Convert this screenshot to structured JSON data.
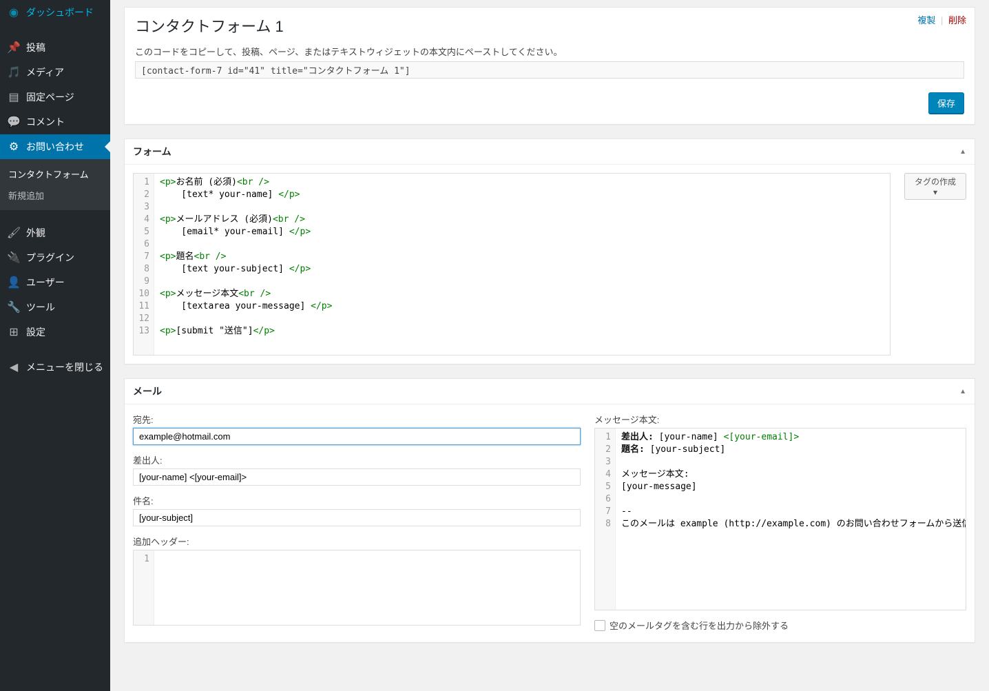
{
  "sidebar": {
    "items": [
      {
        "icon": "dashboard",
        "label": "ダッシュボード"
      },
      {
        "icon": "posts",
        "label": "投稿"
      },
      {
        "icon": "media",
        "label": "メディア"
      },
      {
        "icon": "pages",
        "label": "固定ページ"
      },
      {
        "icon": "comments",
        "label": "コメント"
      },
      {
        "icon": "contact",
        "label": "お問い合わせ",
        "current": true
      },
      {
        "icon": "appearance",
        "label": "外観"
      },
      {
        "icon": "plugins",
        "label": "プラグイン"
      },
      {
        "icon": "users",
        "label": "ユーザー"
      },
      {
        "icon": "tools",
        "label": "ツール"
      },
      {
        "icon": "settings",
        "label": "設定"
      },
      {
        "icon": "collapse",
        "label": "メニューを閉じる"
      }
    ],
    "submenu": [
      {
        "label": "コンタクトフォーム"
      },
      {
        "label": "新規追加"
      }
    ]
  },
  "title_actions": {
    "duplicate": "複製",
    "delete": "削除"
  },
  "page_title": "コンタクトフォーム 1",
  "shortcode_desc": "このコードをコピーして、投稿、ページ、またはテキストウィジェットの本文内にペーストしてください。",
  "shortcode_value": "[contact-form-7 id=\"41\" title=\"コンタクトフォーム 1\"]",
  "save_label": "保存",
  "form_section": {
    "title": "フォーム",
    "tag_button": "タグの作成 ▾",
    "code_lines": [
      {
        "n": 1,
        "parts": [
          {
            "t": "<p>",
            "c": "g"
          },
          {
            "t": "お名前 (必須)",
            "c": "d"
          },
          {
            "t": "<br />",
            "c": "g"
          }
        ]
      },
      {
        "n": 2,
        "parts": [
          {
            "t": "    [text* your-name] ",
            "c": "d"
          },
          {
            "t": "</p>",
            "c": "g"
          }
        ]
      },
      {
        "n": 3,
        "parts": []
      },
      {
        "n": 4,
        "parts": [
          {
            "t": "<p>",
            "c": "g"
          },
          {
            "t": "メールアドレス (必須)",
            "c": "d"
          },
          {
            "t": "<br />",
            "c": "g"
          }
        ]
      },
      {
        "n": 5,
        "parts": [
          {
            "t": "    [email* your-email] ",
            "c": "d"
          },
          {
            "t": "</p>",
            "c": "g"
          }
        ]
      },
      {
        "n": 6,
        "parts": []
      },
      {
        "n": 7,
        "parts": [
          {
            "t": "<p>",
            "c": "g"
          },
          {
            "t": "題名",
            "c": "d"
          },
          {
            "t": "<br />",
            "c": "g"
          }
        ]
      },
      {
        "n": 8,
        "parts": [
          {
            "t": "    [text your-subject] ",
            "c": "d"
          },
          {
            "t": "</p>",
            "c": "g"
          }
        ]
      },
      {
        "n": 9,
        "parts": []
      },
      {
        "n": 10,
        "parts": [
          {
            "t": "<p>",
            "c": "g"
          },
          {
            "t": "メッセージ本文",
            "c": "d"
          },
          {
            "t": "<br />",
            "c": "g"
          }
        ]
      },
      {
        "n": 11,
        "parts": [
          {
            "t": "    [textarea your-message] ",
            "c": "d"
          },
          {
            "t": "</p>",
            "c": "g"
          }
        ]
      },
      {
        "n": 12,
        "parts": []
      },
      {
        "n": 13,
        "parts": [
          {
            "t": "<p>",
            "c": "g"
          },
          {
            "t": "[submit \"送信\"]",
            "c": "d"
          },
          {
            "t": "</p>",
            "c": "g"
          }
        ]
      }
    ]
  },
  "mail_section": {
    "title": "メール",
    "to_label": "宛先:",
    "to_value": "example@hotmail.com",
    "from_label": "差出人:",
    "from_value": "[your-name] <[your-email]>",
    "subject_label": "件名:",
    "subject_value": "[your-subject]",
    "headers_label": "追加ヘッダー:",
    "body_label": "メッセージ本文:",
    "body_lines": [
      {
        "n": 1,
        "parts": [
          {
            "t": "差出人:",
            "c": "b"
          },
          {
            "t": " [your-name] ",
            "c": "d"
          },
          {
            "t": "<[your-email]>",
            "c": "g"
          }
        ]
      },
      {
        "n": 2,
        "parts": [
          {
            "t": "題名:",
            "c": "b"
          },
          {
            "t": " [your-subject]",
            "c": "d"
          }
        ]
      },
      {
        "n": 3,
        "parts": []
      },
      {
        "n": 4,
        "parts": [
          {
            "t": "メッセージ本文:",
            "c": "d"
          }
        ]
      },
      {
        "n": 5,
        "parts": [
          {
            "t": "[your-message]",
            "c": "d"
          }
        ]
      },
      {
        "n": 6,
        "parts": []
      },
      {
        "n": 7,
        "parts": [
          {
            "t": "--",
            "c": "d"
          }
        ]
      },
      {
        "n": 8,
        "parts": [
          {
            "t": "このメールは example (http://example.com) のお問い合わせフォームから送信されました",
            "c": "d"
          }
        ]
      }
    ],
    "exclude_blank_label": "空のメールタグを含む行を出力から除外する"
  }
}
